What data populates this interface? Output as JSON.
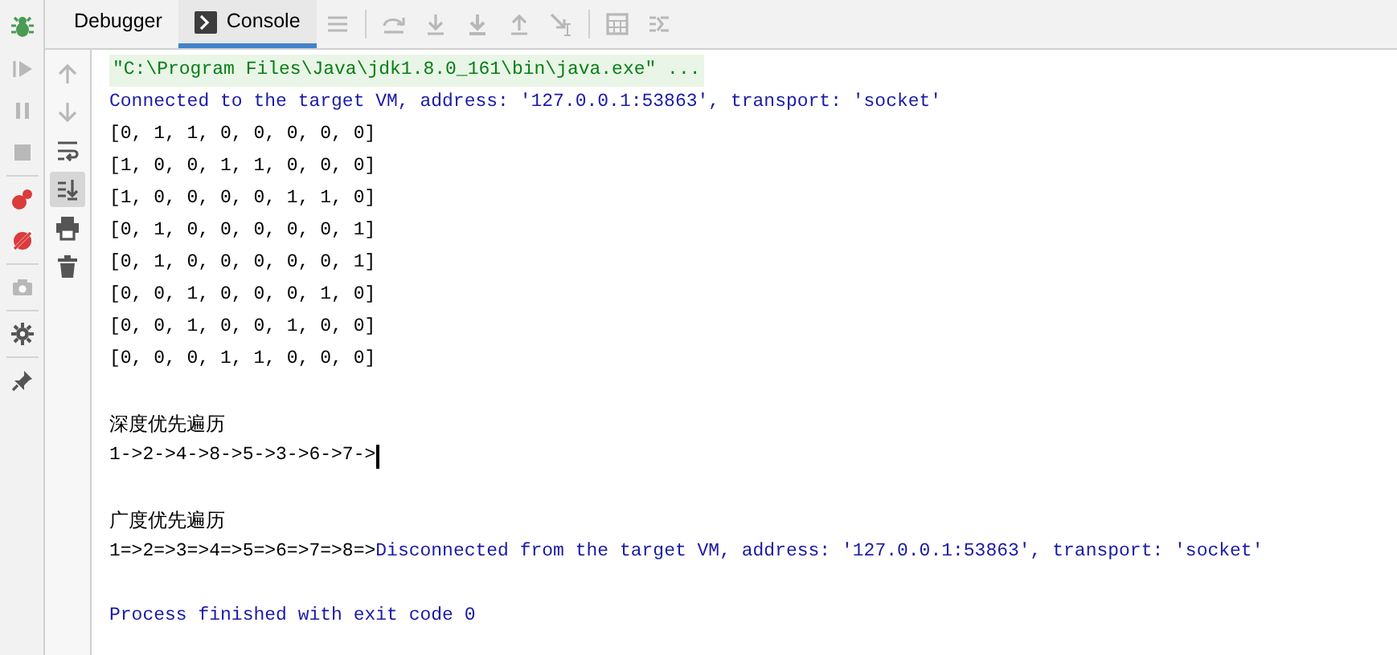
{
  "debug_tools": [
    {
      "kind": "bug",
      "disabled": false
    },
    {
      "kind": "resume",
      "disabled": true
    },
    {
      "kind": "pause",
      "disabled": true
    },
    {
      "kind": "stop",
      "disabled": true
    },
    {
      "kind": "breakpoints",
      "disabled": false
    },
    {
      "kind": "mute",
      "disabled": false
    },
    {
      "kind": "camera",
      "disabled": true
    },
    {
      "kind": "gear",
      "disabled": false
    },
    {
      "kind": "pin",
      "disabled": false
    }
  ],
  "tabs": [
    {
      "label": "Debugger",
      "selected": false,
      "kind": "plain"
    },
    {
      "label": "Console",
      "selected": true,
      "kind": "console"
    }
  ],
  "toolbar": [
    {
      "kind": "menu",
      "disabled": true
    },
    {
      "kind": "step-over",
      "disabled": true
    },
    {
      "kind": "step-into",
      "disabled": true
    },
    {
      "kind": "force-step",
      "disabled": true
    },
    {
      "kind": "step-out",
      "disabled": true
    },
    {
      "kind": "run-cursor",
      "disabled": true
    },
    {
      "kind": "evaluate",
      "disabled": true
    },
    {
      "kind": "trace",
      "disabled": true
    }
  ],
  "console_tools": [
    {
      "kind": "up",
      "disabled": true,
      "selected": false
    },
    {
      "kind": "down",
      "disabled": true,
      "selected": false
    },
    {
      "kind": "wrap",
      "disabled": false,
      "selected": false
    },
    {
      "kind": "scroll-end",
      "disabled": false,
      "selected": true
    },
    {
      "kind": "print",
      "disabled": false,
      "selected": false
    },
    {
      "kind": "trash",
      "disabled": false,
      "selected": false
    }
  ],
  "console_lines": [
    {
      "cursor": false,
      "segments": [
        {
          "kind": "command",
          "text": "\"C:\\Program Files\\Java\\jdk1.8.0_161\\bin\\java.exe\" ..."
        }
      ]
    },
    {
      "cursor": false,
      "segments": [
        {
          "kind": "system",
          "text": "Connected to the target VM, address: '127.0.0.1:53863', transport: 'socket'"
        }
      ]
    },
    {
      "cursor": false,
      "segments": [
        {
          "kind": "output",
          "text": "[0, 1, 1, 0, 0, 0, 0, 0]"
        }
      ]
    },
    {
      "cursor": false,
      "segments": [
        {
          "kind": "output",
          "text": "[1, 0, 0, 1, 1, 0, 0, 0]"
        }
      ]
    },
    {
      "cursor": false,
      "segments": [
        {
          "kind": "output",
          "text": "[1, 0, 0, 0, 0, 1, 1, 0]"
        }
      ]
    },
    {
      "cursor": false,
      "segments": [
        {
          "kind": "output",
          "text": "[0, 1, 0, 0, 0, 0, 0, 1]"
        }
      ]
    },
    {
      "cursor": false,
      "segments": [
        {
          "kind": "output",
          "text": "[0, 1, 0, 0, 0, 0, 0, 1]"
        }
      ]
    },
    {
      "cursor": false,
      "segments": [
        {
          "kind": "output",
          "text": "[0, 0, 1, 0, 0, 0, 1, 0]"
        }
      ]
    },
    {
      "cursor": false,
      "segments": [
        {
          "kind": "output",
          "text": "[0, 0, 1, 0, 0, 1, 0, 0]"
        }
      ]
    },
    {
      "cursor": false,
      "segments": [
        {
          "kind": "output",
          "text": "[0, 0, 0, 1, 1, 0, 0, 0]"
        }
      ]
    },
    {
      "cursor": false
    },
    {
      "cursor": false,
      "segments": [
        {
          "kind": "output",
          "text": "深度优先遍历"
        }
      ]
    },
    {
      "cursor": true,
      "segments": [
        {
          "kind": "output",
          "text": "1->2->4->8->5->3->6->7->"
        }
      ]
    },
    {
      "cursor": false
    },
    {
      "cursor": false,
      "segments": [
        {
          "kind": "output",
          "text": "广度优先遍历"
        }
      ]
    },
    {
      "cursor": false,
      "segments": [
        {
          "kind": "output",
          "text": "1=>2=>3=>4=>5=>6=>7=>8=>"
        },
        {
          "kind": "system",
          "text": "Disconnected from the target VM, address: '127.0.0.1:53863', transport: 'socket'"
        }
      ]
    },
    {
      "cursor": false
    },
    {
      "cursor": false,
      "segments": [
        {
          "kind": "system",
          "text": "Process finished with exit code 0"
        }
      ]
    }
  ]
}
